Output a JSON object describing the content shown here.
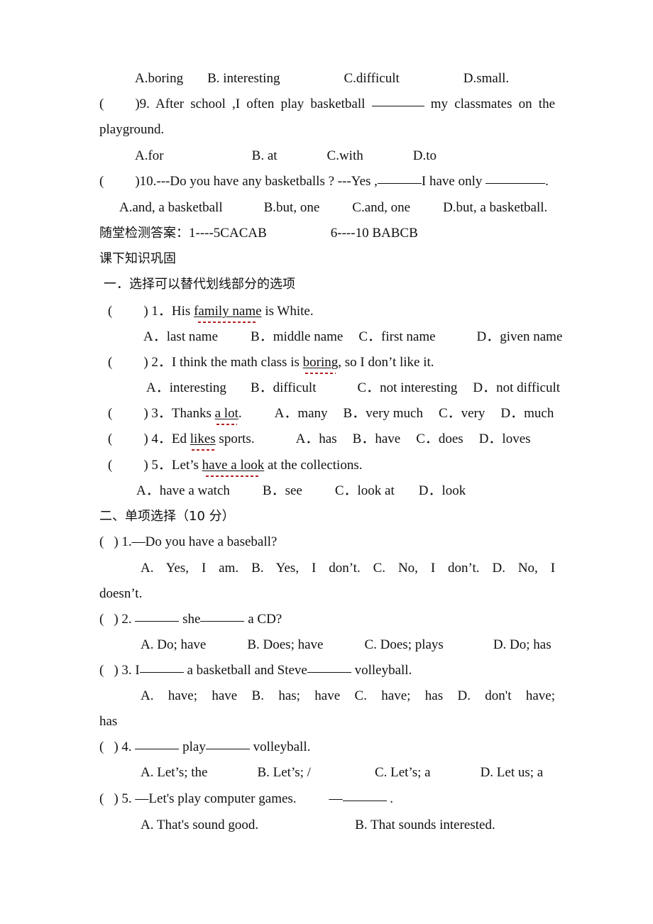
{
  "document": {
    "background": "#ffffff",
    "text_color": "#111111",
    "proofing_mark_color": "#b32020"
  },
  "top_section": {
    "q8_options": {
      "a": "A.boring",
      "b": "B. interesting",
      "c": "C.difficult",
      "d": "D.small."
    },
    "q9": {
      "bracket_open": "(",
      "bracket_close": ")9.",
      "text_before": "After  school  ,I  often  play  basketball",
      "text_after": "my  classmates  on  the",
      "continuation": "playground."
    },
    "q9_options": {
      "a": "A.for",
      "b": "B. at",
      "c": "C.with",
      "d": "D.to"
    },
    "q10": {
      "bracket_open": "(",
      "bracket_close": ")10.",
      "text_part1": "---Do you have any basketballs ? ---Yes ,",
      "text_part2": "I have only",
      "text_part3": "."
    },
    "q10_options": {
      "a": "A.and, a basketball",
      "b": "B.but, one",
      "c": "C.and, one",
      "d": "D.but,   a basketball."
    },
    "answer_key": {
      "label": "随堂检测答案：",
      "range1": "1----5CACAB",
      "range2": "6----10 BABCB"
    }
  },
  "section_one": {
    "heading": "课下知识巩固",
    "title": "一．选择可以替代划线部分的选项",
    "questions": [
      {
        "bracket_open": "(",
        "bracket_close": ")",
        "number": "1．",
        "stem_before": "His ",
        "stem_underlined": "family name",
        "stem_after": " is White.",
        "options": {
          "a": "A．last name",
          "b": "B．middle name",
          "c": "C．first name",
          "d": "D．given name"
        }
      },
      {
        "bracket_open": "(",
        "bracket_close": ")",
        "number": "2．",
        "stem_before": "I think the math class is ",
        "stem_underlined": "boring",
        "stem_after": ", so I don’t like it.",
        "options": {
          "a": "A．interesting",
          "b": "B．difficult",
          "c": "C．not interesting",
          "d": "D．not difficult"
        }
      },
      {
        "bracket_open": "(",
        "bracket_close": ")",
        "number": "3．",
        "stem_before": "Thanks ",
        "stem_underlined": "a lot",
        "stem_after": ".",
        "options": {
          "a": "A．many",
          "b": "B．very much",
          "c": "C．very",
          "d": "D．much"
        }
      },
      {
        "bracket_open": "(",
        "bracket_close": ")",
        "number": "4．",
        "stem_before": "Ed ",
        "stem_underlined": "likes",
        "stem_after": " sports.",
        "options": {
          "a": "A．has",
          "b": "B．have",
          "c": "C．does",
          "d": "D．loves"
        }
      },
      {
        "bracket_open": "(",
        "bracket_close": ")",
        "number": "5．",
        "stem_before": "Let’s ",
        "stem_underlined": "have a look",
        "stem_after": " at the collections.",
        "options": {
          "a": "A．have a watch",
          "b": "B．see",
          "c": "C．look at",
          "d": "D．look"
        }
      }
    ]
  },
  "section_two": {
    "title": "二、单项选择（10 分）",
    "questions": [
      {
        "bracket_open": "(",
        "bracket_close": ")",
        "number": "1.",
        "stem": "—Do you have a baseball?",
        "options": {
          "a": "A. Yes, I  am.",
          "b": "B. Yes, I  don’t.",
          "c": "C. No,  I  don’t.",
          "d": "D. No,  I",
          "d_wrap": "doesn’t."
        }
      },
      {
        "bracket_open": "(",
        "bracket_close": ")",
        "number": "2.",
        "stem_mid": "she",
        "stem_end": "a CD?",
        "options": {
          "a": "A. Do; have",
          "b": "B. Does; have",
          "c": "C. Does; plays",
          "d": "D. Do; has"
        }
      },
      {
        "bracket_open": "(",
        "bracket_close": ")",
        "number": "3.",
        "stem_start": "I",
        "stem_mid": "a basketball and Steve",
        "stem_end": "volleyball.",
        "options": {
          "a": "A. have;  have",
          "b": "B. has;  have",
          "c": "C. have;  has",
          "d": "D. don't have;",
          "d_wrap": "has"
        }
      },
      {
        "bracket_open": "(",
        "bracket_close": ")",
        "number": "4.",
        "stem_mid": "play",
        "stem_end": "volleyball.",
        "options": {
          "a": "A. Let’s; the",
          "b": "B. Let’s; /",
          "c": "C. Let’s; a",
          "d": "D. Let us; a"
        }
      },
      {
        "bracket_open": "(",
        "bracket_close": ")",
        "number": "5.",
        "stem": "—Let's play computer games.",
        "stem_dash": "—",
        "stem_end": ".",
        "options": {
          "a": "A. That's sound good.",
          "b": "B. That sounds interested."
        }
      }
    ]
  }
}
